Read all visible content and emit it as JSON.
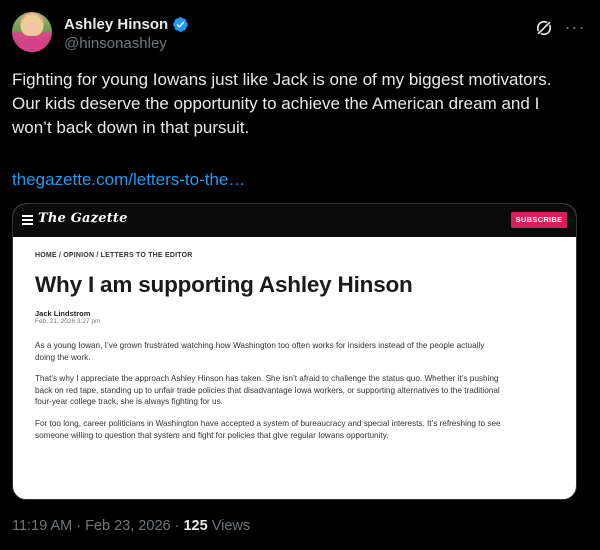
{
  "author": {
    "display_name": "Ashley Hinson",
    "handle": "@hinsonashley"
  },
  "icons": {
    "verified": "verified-badge-icon",
    "grok": "grok-icon",
    "more": "more-options-icon",
    "menu": "hamburger-menu-icon",
    "verified_color": "#1d9bf0"
  },
  "tweet": {
    "text_line_1": "Fighting for young Iowans just like Jack is one of my biggest motivators.",
    "text_line_2": "Our kids deserve the opportunity to achieve the American dream and I",
    "text_line_3": "won’t back down in that pursuit.",
    "link": "thegazette.com/letters-to-the…"
  },
  "card": {
    "masthead": "The Gazette",
    "subscribe_label": "SUBSCRIBE",
    "subscribe_color": "#d91e5b",
    "breadcrumb": "HOME / OPINION / LETTERS TO THE EDITOR",
    "headline": "Why I am supporting Ashley Hinson",
    "article_author": "Jack Lindstrom",
    "article_date": "Feb. 21, 2026 3:27 pm",
    "paragraphs": [
      "As a young Iowan, I’ve grown frustrated watching how Washington too often works for insiders instead of the people actually doing the work.",
      "That’s why I appreciate the approach Ashley Hinson has taken. She isn’t afraid to challenge the status quo. Whether it’s pushing back on red tape, standing up to unfair trade policies that disadvantage Iowa workers, or supporting alternatives to the traditional four-year college track, she is always fighting for us.",
      "For too long, career politicians in Washington have accepted a system of bureaucracy and special interests. It’s refreshing to see someone willing to question that system and fight for policies that give regular Iowans opportunity."
    ]
  },
  "footer": {
    "time": "11:19 AM",
    "separator": "·",
    "date": "Feb 23, 2026",
    "views_count": "125",
    "views_label": "Views"
  }
}
